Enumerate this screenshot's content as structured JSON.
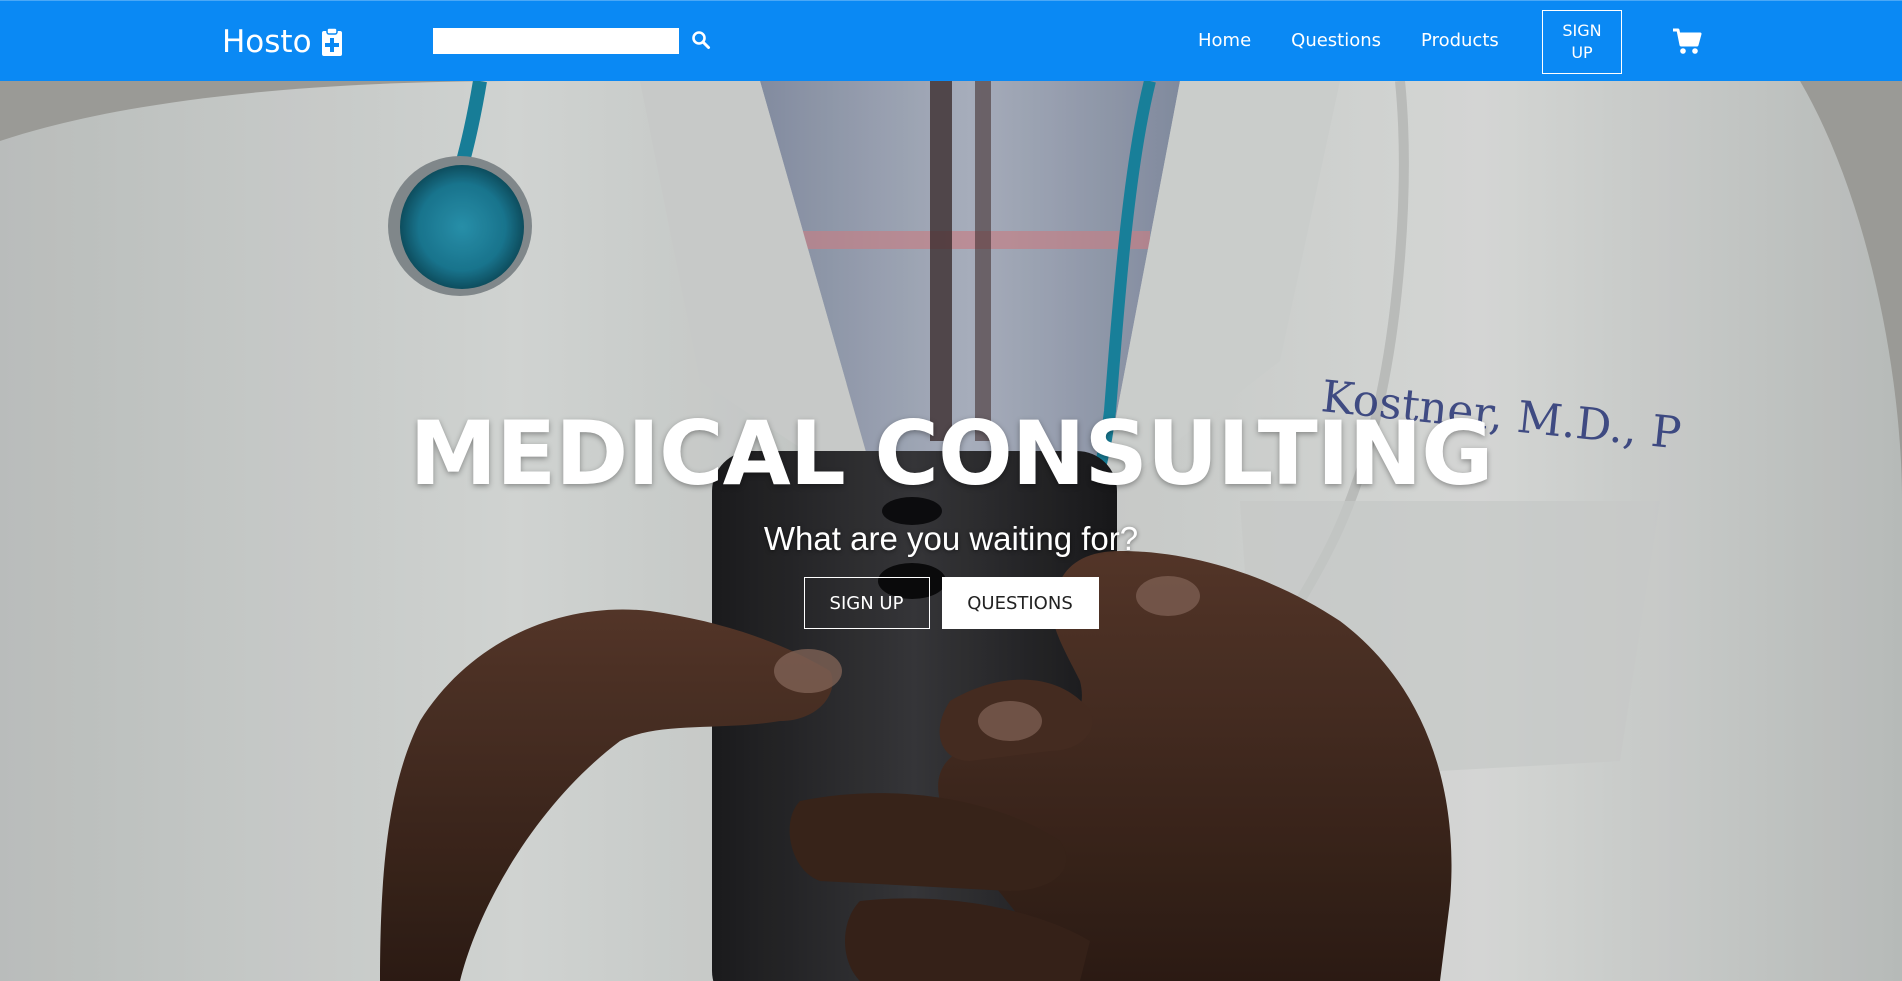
{
  "navbar": {
    "brand": "Hosto",
    "brand_icon": "clipboard-plus-icon",
    "search": {
      "value": "",
      "placeholder": ""
    },
    "search_icon": "search-icon",
    "links": [
      "Home",
      "Questions",
      "Products"
    ],
    "signup_label": "SIGN UP",
    "cart_icon": "shopping-cart-icon",
    "background": "#0a89f4"
  },
  "hero": {
    "title": "MEDICAL CONSULTING",
    "subtitle": "What are you waiting for?",
    "primary_button": "SIGN UP",
    "secondary_button": "QUESTIONS"
  }
}
